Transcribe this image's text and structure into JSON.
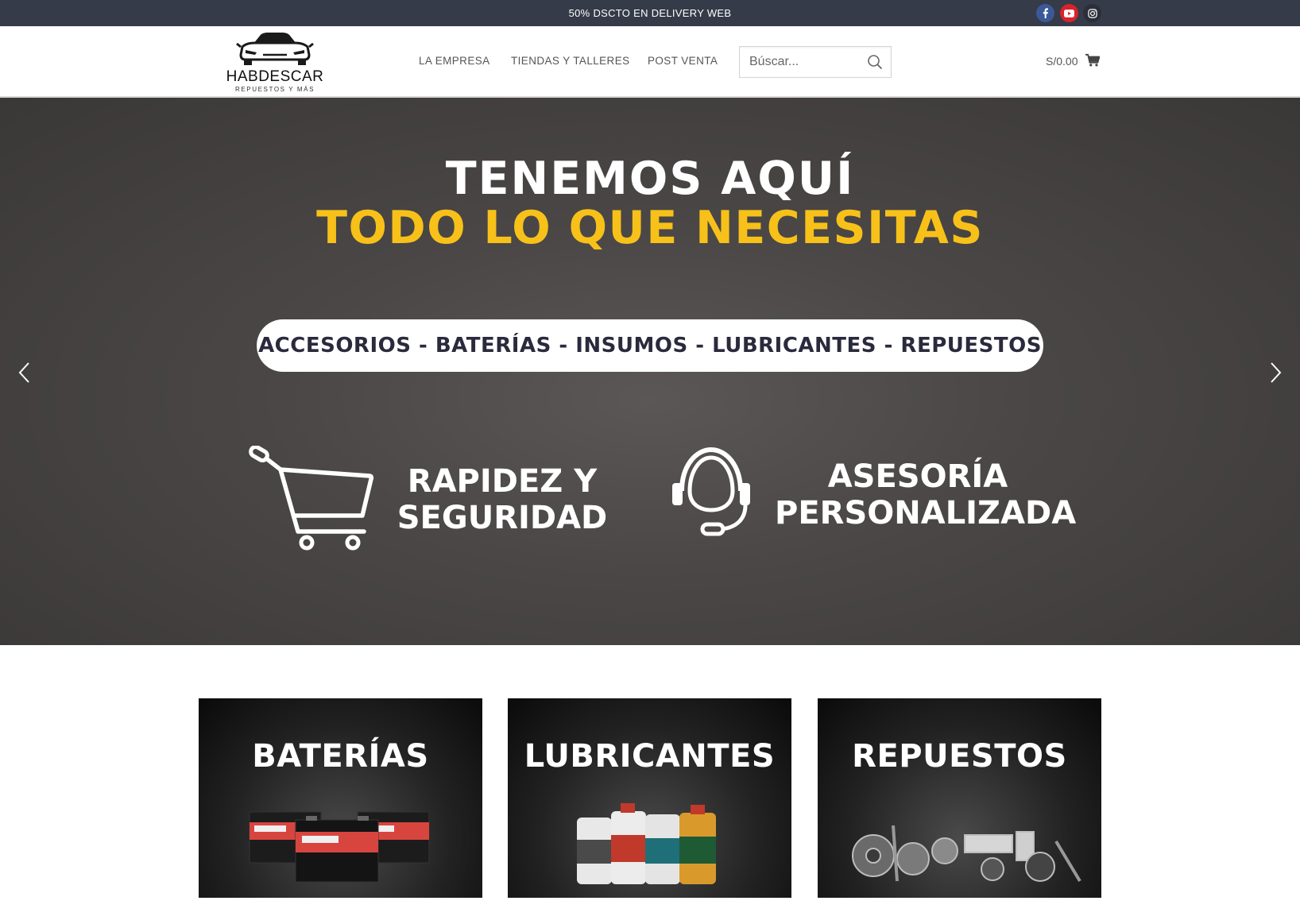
{
  "topbar": {
    "promo": "50% DSCTO EN DELIVERY WEB",
    "social": [
      {
        "icon": "facebook-icon",
        "color": "#3b5998"
      },
      {
        "icon": "youtube-icon",
        "color": "#d9232a"
      },
      {
        "icon": "instagram-icon",
        "color": "#2a2f3a"
      }
    ]
  },
  "header": {
    "logo": {
      "name": "HABDESCAR",
      "tagline": "REPUESTOS Y MÁS"
    },
    "nav": [
      "LA EMPRESA",
      "TIENDAS Y TALLERES",
      "POST VENTA"
    ],
    "search": {
      "placeholder": "Búscar..."
    },
    "cart": {
      "total": "S/0.00"
    }
  },
  "hero": {
    "line1": "TENEMOS AQUÍ",
    "line2": "TODO LO QUE NECESITAS",
    "categories_pill": "ACCESORIOS - BATERÍAS - INSUMOS - LUBRICANTES - REPUESTOS",
    "features": [
      {
        "icon": "shopping-cart-icon",
        "line1": "RAPIDEZ Y",
        "line2": "SEGURIDAD"
      },
      {
        "icon": "headset-icon",
        "line1": "ASESORÍA",
        "line2": "PERSONALIZADA"
      }
    ],
    "accent_color": "#f7c11a"
  },
  "categories": [
    {
      "title": "BATERÍAS"
    },
    {
      "title": "LUBRICANTES"
    },
    {
      "title": "REPUESTOS"
    }
  ]
}
